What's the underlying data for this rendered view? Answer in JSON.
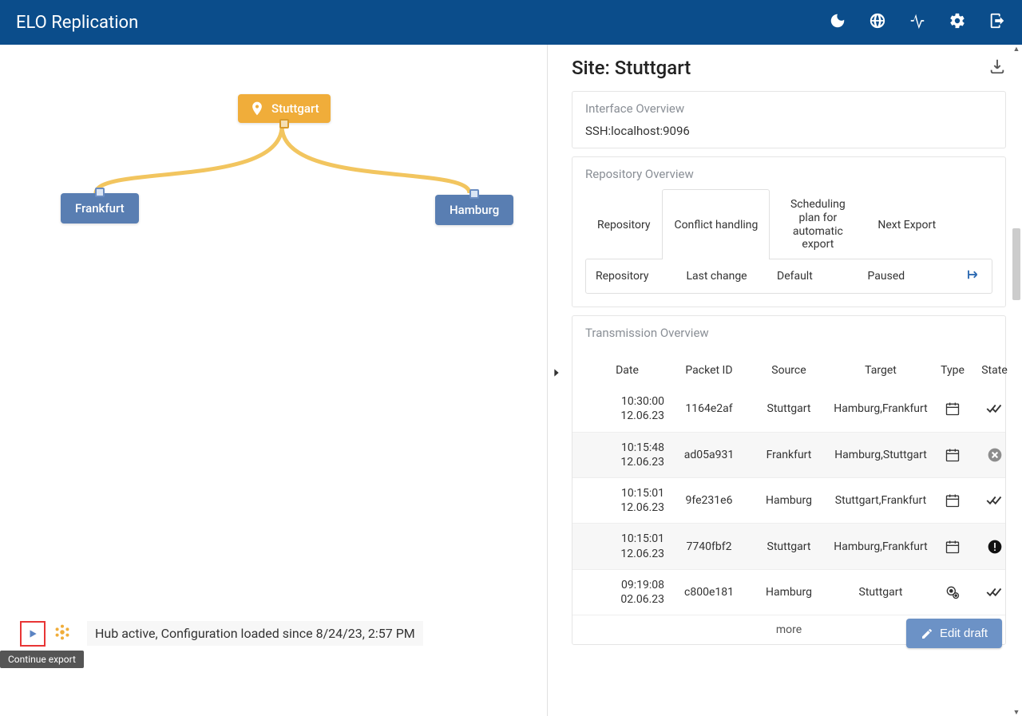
{
  "header": {
    "title": "ELO Replication"
  },
  "diagram": {
    "hub": "Stuttgart",
    "children": [
      "Frankfurt",
      "Hamburg"
    ]
  },
  "panel": {
    "title": "Site: Stuttgart",
    "interface_section": "Interface Overview",
    "interface_value": "SSH:localhost:9096",
    "repo_section": "Repository Overview",
    "tabs": [
      "Repository",
      "Conflict handling",
      "Scheduling plan for automatic export",
      "Next Export"
    ],
    "repo_cols": [
      "Repository",
      "Last change",
      "Default",
      "Paused"
    ],
    "trans_section": "Transmission Overview",
    "trans_cols": [
      "Date",
      "Packet ID",
      "Source",
      "Target",
      "Type",
      "State"
    ],
    "rows": [
      {
        "time": "10:30:00",
        "date": "12.06.23",
        "id": "1164e2af",
        "src": "Stuttgart",
        "tgt": "Hamburg,Frankfurt",
        "type": "calendar",
        "state": "done"
      },
      {
        "time": "10:15:48",
        "date": "12.06.23",
        "id": "ad05a931",
        "src": "Frankfurt",
        "tgt": "Hamburg,Stuttgart",
        "type": "calendar",
        "state": "error"
      },
      {
        "time": "10:15:01",
        "date": "12.06.23",
        "id": "9fe231e6",
        "src": "Hamburg",
        "tgt": "Stuttgart,Frankfurt",
        "type": "calendar",
        "state": "done"
      },
      {
        "time": "10:15:01",
        "date": "12.06.23",
        "id": "7740fbf2",
        "src": "Stuttgart",
        "tgt": "Hamburg,Frankfurt",
        "type": "calendar",
        "state": "warn"
      },
      {
        "time": "09:19:08",
        "date": "02.06.23",
        "id": "c800e181",
        "src": "Hamburg",
        "tgt": "Stuttgart",
        "type": "gear",
        "state": "done"
      }
    ],
    "more": "more"
  },
  "footer": {
    "status": "Hub active, Configuration loaded since 8/24/23, 2:57 PM",
    "edit": "Edit draft",
    "tooltip": "Continue export"
  }
}
